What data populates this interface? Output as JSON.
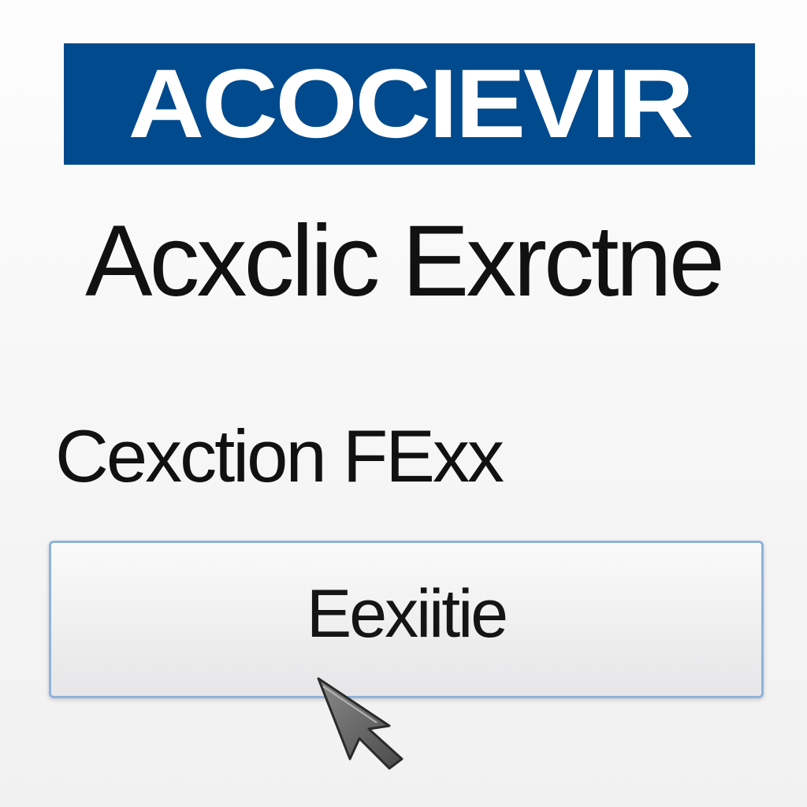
{
  "banner": {
    "title": "ACOCIEVIR",
    "background_color": "#004a8d",
    "text_color": "#ffffff"
  },
  "heading": {
    "text": "Acxclic Exrctne"
  },
  "subheading": {
    "text": "Cexction FExx"
  },
  "button": {
    "label": "Eexiitie",
    "border_color": "#8fb2dc"
  },
  "cursor": {
    "icon": "arrow-pointer-icon"
  }
}
